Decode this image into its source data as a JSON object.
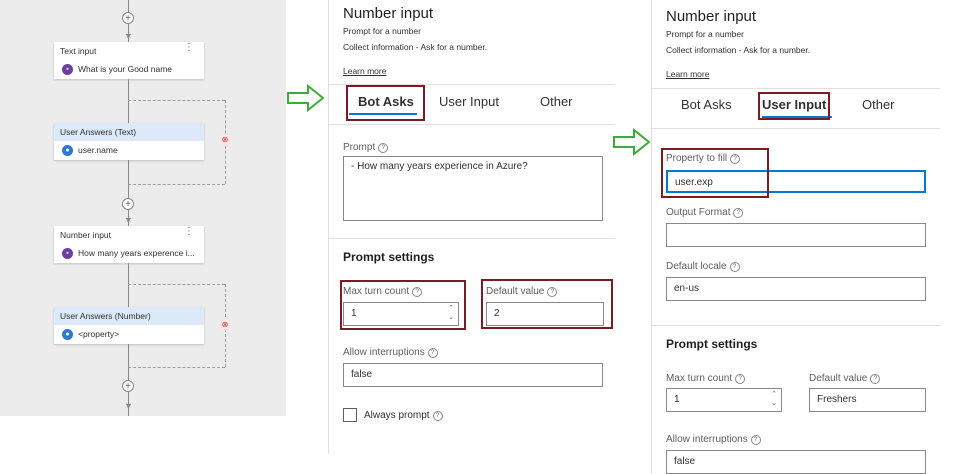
{
  "canvas": {
    "nodes": [
      {
        "title": "Text input",
        "body": "What is your Good name",
        "icon": "chat-icon"
      },
      {
        "title": "User Answers (Text)",
        "body": "user.name",
        "icon": "user-icon"
      },
      {
        "title": "Number input",
        "body": "How many years experence i...",
        "icon": "chat-icon"
      },
      {
        "title": "User Answers (Number)",
        "body": "<property>",
        "icon": "user-icon"
      }
    ]
  },
  "panel1": {
    "title": "Number input",
    "subtitle": "Prompt for a number",
    "description": "Collect information - Ask for a number.",
    "learn_more": "Learn more",
    "tabs": [
      "Bot Asks",
      "User Input",
      "Other"
    ],
    "active_tab": "Bot Asks",
    "prompt_label": "Prompt",
    "prompt_value": "- How many years experience in Azure?",
    "prompt_settings": "Prompt settings",
    "max_turn_label": "Max turn count",
    "max_turn_value": "1",
    "default_value_label": "Default value",
    "default_value": "2",
    "allow_interruptions_label": "Allow interruptions",
    "allow_interruptions_value": "false",
    "always_prompt_label": "Always prompt"
  },
  "panel2": {
    "title": "Number input",
    "subtitle": "Prompt for a number",
    "description": "Collect information - Ask for a number.",
    "learn_more": "Learn more",
    "tabs": [
      "Bot Asks",
      "User Input",
      "Other"
    ],
    "active_tab": "User Input",
    "property_label": "Property to fill",
    "property_value": "user.exp",
    "output_format_label": "Output Format",
    "output_format_value": "",
    "default_locale_label": "Default locale",
    "default_locale_value": "en-us",
    "prompt_settings": "Prompt settings",
    "max_turn_label": "Max turn count",
    "max_turn_value": "1",
    "default_value_label": "Default value",
    "default_value": "Freshers",
    "allow_interruptions_label": "Allow interruptions",
    "allow_interruptions_value": "false"
  },
  "colors": {
    "highlight_box": "#7b1c24",
    "arrow": "#3daa3d",
    "tab_underline": "#0078d4",
    "focus_border": "#0078d4"
  }
}
